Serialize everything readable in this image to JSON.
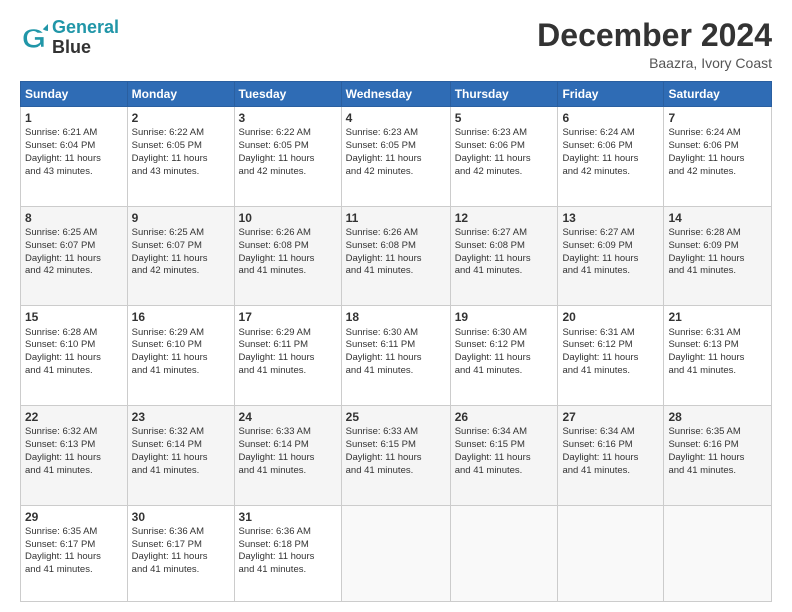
{
  "header": {
    "logo_line1": "General",
    "logo_line2": "Blue",
    "month": "December 2024",
    "location": "Baazra, Ivory Coast"
  },
  "days_of_week": [
    "Sunday",
    "Monday",
    "Tuesday",
    "Wednesday",
    "Thursday",
    "Friday",
    "Saturday"
  ],
  "weeks": [
    [
      {
        "day": "1",
        "info": "Sunrise: 6:21 AM\nSunset: 6:04 PM\nDaylight: 11 hours\nand 43 minutes."
      },
      {
        "day": "2",
        "info": "Sunrise: 6:22 AM\nSunset: 6:05 PM\nDaylight: 11 hours\nand 43 minutes."
      },
      {
        "day": "3",
        "info": "Sunrise: 6:22 AM\nSunset: 6:05 PM\nDaylight: 11 hours\nand 42 minutes."
      },
      {
        "day": "4",
        "info": "Sunrise: 6:23 AM\nSunset: 6:05 PM\nDaylight: 11 hours\nand 42 minutes."
      },
      {
        "day": "5",
        "info": "Sunrise: 6:23 AM\nSunset: 6:06 PM\nDaylight: 11 hours\nand 42 minutes."
      },
      {
        "day": "6",
        "info": "Sunrise: 6:24 AM\nSunset: 6:06 PM\nDaylight: 11 hours\nand 42 minutes."
      },
      {
        "day": "7",
        "info": "Sunrise: 6:24 AM\nSunset: 6:06 PM\nDaylight: 11 hours\nand 42 minutes."
      }
    ],
    [
      {
        "day": "8",
        "info": "Sunrise: 6:25 AM\nSunset: 6:07 PM\nDaylight: 11 hours\nand 42 minutes."
      },
      {
        "day": "9",
        "info": "Sunrise: 6:25 AM\nSunset: 6:07 PM\nDaylight: 11 hours\nand 42 minutes."
      },
      {
        "day": "10",
        "info": "Sunrise: 6:26 AM\nSunset: 6:08 PM\nDaylight: 11 hours\nand 41 minutes."
      },
      {
        "day": "11",
        "info": "Sunrise: 6:26 AM\nSunset: 6:08 PM\nDaylight: 11 hours\nand 41 minutes."
      },
      {
        "day": "12",
        "info": "Sunrise: 6:27 AM\nSunset: 6:08 PM\nDaylight: 11 hours\nand 41 minutes."
      },
      {
        "day": "13",
        "info": "Sunrise: 6:27 AM\nSunset: 6:09 PM\nDaylight: 11 hours\nand 41 minutes."
      },
      {
        "day": "14",
        "info": "Sunrise: 6:28 AM\nSunset: 6:09 PM\nDaylight: 11 hours\nand 41 minutes."
      }
    ],
    [
      {
        "day": "15",
        "info": "Sunrise: 6:28 AM\nSunset: 6:10 PM\nDaylight: 11 hours\nand 41 minutes."
      },
      {
        "day": "16",
        "info": "Sunrise: 6:29 AM\nSunset: 6:10 PM\nDaylight: 11 hours\nand 41 minutes."
      },
      {
        "day": "17",
        "info": "Sunrise: 6:29 AM\nSunset: 6:11 PM\nDaylight: 11 hours\nand 41 minutes."
      },
      {
        "day": "18",
        "info": "Sunrise: 6:30 AM\nSunset: 6:11 PM\nDaylight: 11 hours\nand 41 minutes."
      },
      {
        "day": "19",
        "info": "Sunrise: 6:30 AM\nSunset: 6:12 PM\nDaylight: 11 hours\nand 41 minutes."
      },
      {
        "day": "20",
        "info": "Sunrise: 6:31 AM\nSunset: 6:12 PM\nDaylight: 11 hours\nand 41 minutes."
      },
      {
        "day": "21",
        "info": "Sunrise: 6:31 AM\nSunset: 6:13 PM\nDaylight: 11 hours\nand 41 minutes."
      }
    ],
    [
      {
        "day": "22",
        "info": "Sunrise: 6:32 AM\nSunset: 6:13 PM\nDaylight: 11 hours\nand 41 minutes."
      },
      {
        "day": "23",
        "info": "Sunrise: 6:32 AM\nSunset: 6:14 PM\nDaylight: 11 hours\nand 41 minutes."
      },
      {
        "day": "24",
        "info": "Sunrise: 6:33 AM\nSunset: 6:14 PM\nDaylight: 11 hours\nand 41 minutes."
      },
      {
        "day": "25",
        "info": "Sunrise: 6:33 AM\nSunset: 6:15 PM\nDaylight: 11 hours\nand 41 minutes."
      },
      {
        "day": "26",
        "info": "Sunrise: 6:34 AM\nSunset: 6:15 PM\nDaylight: 11 hours\nand 41 minutes."
      },
      {
        "day": "27",
        "info": "Sunrise: 6:34 AM\nSunset: 6:16 PM\nDaylight: 11 hours\nand 41 minutes."
      },
      {
        "day": "28",
        "info": "Sunrise: 6:35 AM\nSunset: 6:16 PM\nDaylight: 11 hours\nand 41 minutes."
      }
    ],
    [
      {
        "day": "29",
        "info": "Sunrise: 6:35 AM\nSunset: 6:17 PM\nDaylight: 11 hours\nand 41 minutes."
      },
      {
        "day": "30",
        "info": "Sunrise: 6:36 AM\nSunset: 6:17 PM\nDaylight: 11 hours\nand 41 minutes."
      },
      {
        "day": "31",
        "info": "Sunrise: 6:36 AM\nSunset: 6:18 PM\nDaylight: 11 hours\nand 41 minutes."
      },
      null,
      null,
      null,
      null
    ]
  ]
}
